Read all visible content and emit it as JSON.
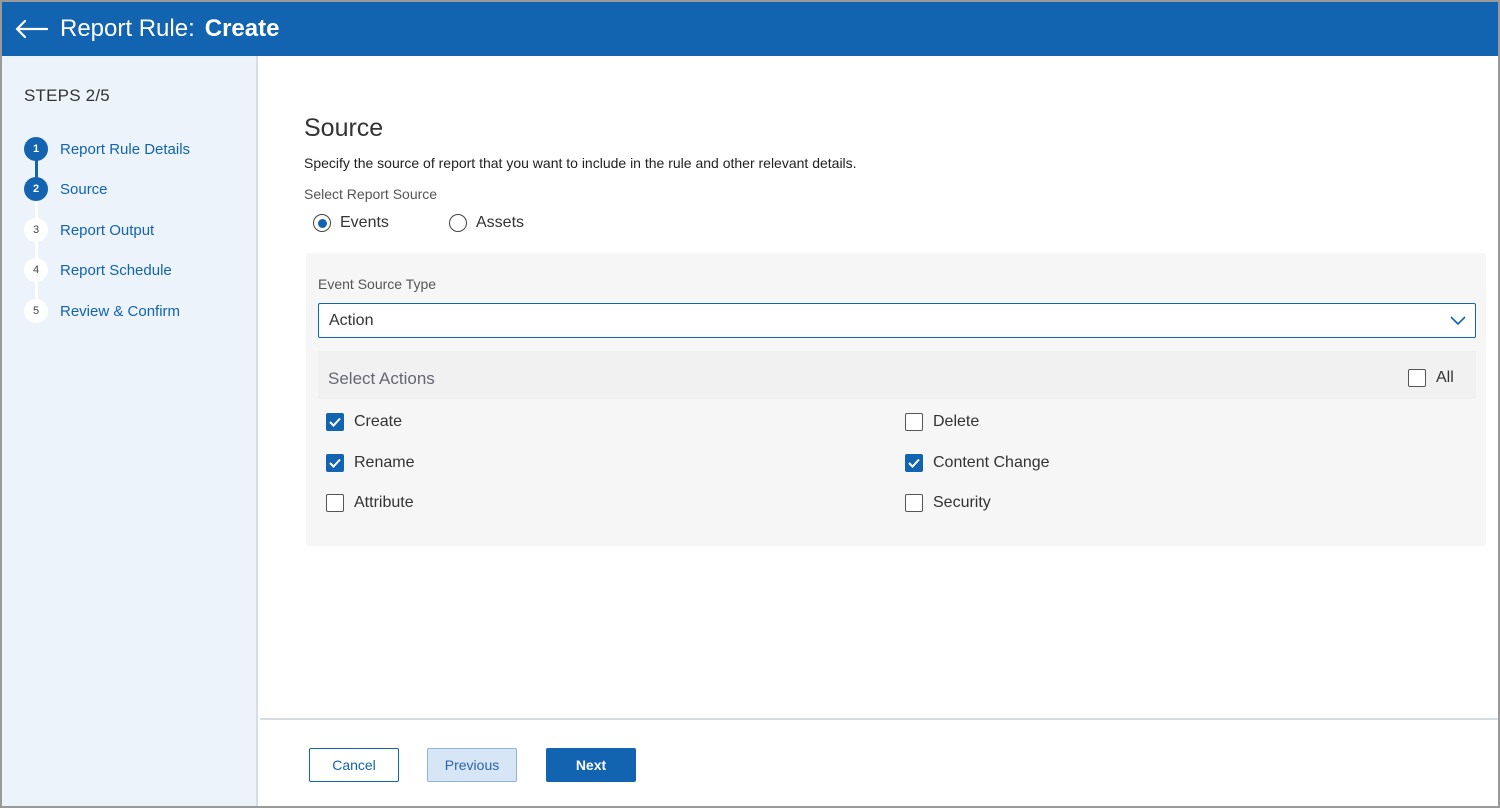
{
  "header": {
    "title": "Report Rule:",
    "title_strong": "Create"
  },
  "sidebar": {
    "steps_label": "STEPS 2/5",
    "steps": [
      {
        "number": "1",
        "label": "Report Rule Details"
      },
      {
        "number": "2",
        "label": "Source"
      },
      {
        "number": "3",
        "label": "Report Output"
      },
      {
        "number": "4",
        "label": "Report Schedule"
      },
      {
        "number": "5",
        "label": "Review & Confirm"
      }
    ]
  },
  "main": {
    "heading": "Source",
    "description": "Specify the source of report that you want to include in the rule and other relevant details.",
    "report_source_label": "Select Report Source",
    "sources": [
      {
        "label": "Events",
        "selected": true
      },
      {
        "label": "Assets",
        "selected": false
      }
    ],
    "event_source_type_label": "Event Source Type",
    "event_source_type_value": "Action",
    "select_actions_label": "Select Actions",
    "all_label": "All",
    "actions": [
      {
        "label": "Create",
        "checked": true
      },
      {
        "label": "Delete",
        "checked": false
      },
      {
        "label": "Rename",
        "checked": true
      },
      {
        "label": "Content Change",
        "checked": true
      },
      {
        "label": "Attribute",
        "checked": false
      },
      {
        "label": "Security",
        "checked": false
      }
    ]
  },
  "footer": {
    "cancel_label": "Cancel",
    "previous_label": "Previous",
    "next_label": "Next"
  },
  "colors": {
    "brand": "#1263b0",
    "sidebar_bg": "#edf3fb",
    "panel_bg": "#f6f6f6"
  }
}
